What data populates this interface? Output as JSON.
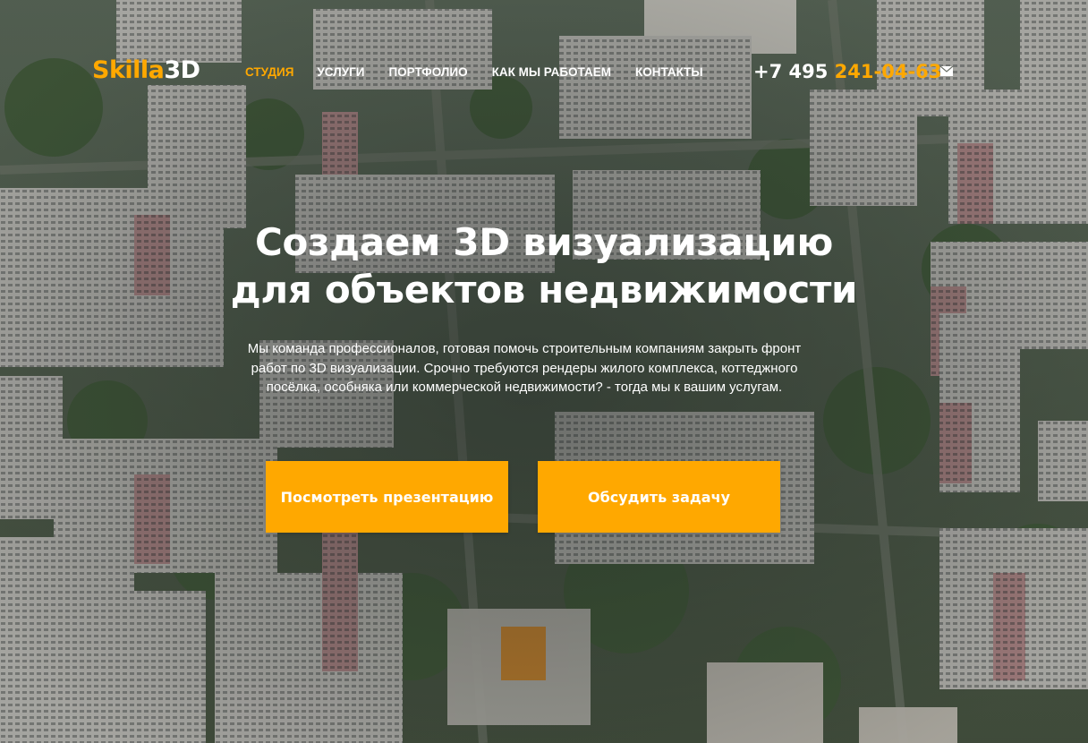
{
  "header": {
    "logo_part1": "Skilla",
    "logo_part2": "3D",
    "nav": [
      {
        "label": "СТУДИЯ",
        "active": true
      },
      {
        "label": "УСЛУГИ",
        "active": false
      },
      {
        "label": "ПОРТФОЛИО",
        "active": false
      },
      {
        "label": "КАК МЫ РАБОТАЕМ",
        "active": false
      },
      {
        "label": "КОНТАКТЫ",
        "active": false
      }
    ],
    "phone_prefix": "+7 495",
    "phone_number": "241-04-63",
    "mail_icon": "envelope-icon"
  },
  "hero": {
    "title_line1": "Создаем 3D визуализацию",
    "title_line2": "для объектов недвижимости",
    "description": "Мы команда профессионалов, готовая помочь строительным компаниям закрыть фронт работ по 3D визуализации. Срочно требуются рендеры жилого комплекса, коттеджного посёлка, особняка или коммерческой недвижимости? - тогда мы к вашим услугам.",
    "btn_presentation": "Посмотреть презентацию",
    "btn_discuss": "Обсудить задачу"
  },
  "colors": {
    "accent": "#ffa800",
    "text": "#ffffff"
  }
}
